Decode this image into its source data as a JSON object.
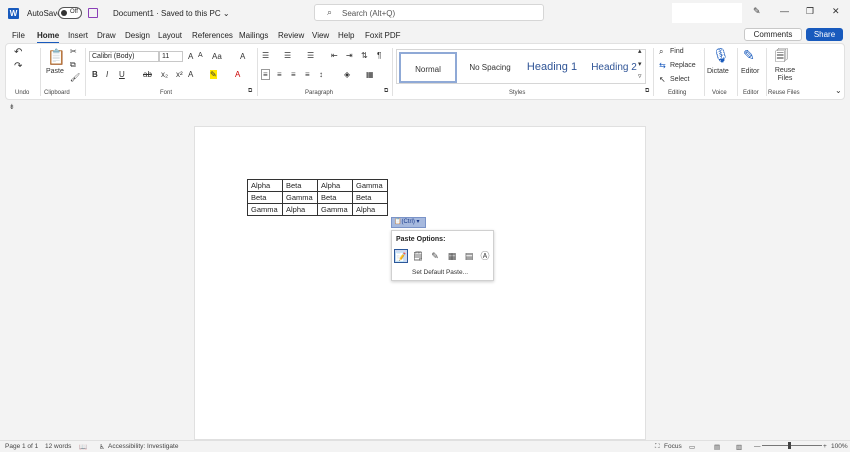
{
  "titlebar": {
    "app_icon": "W",
    "autosave_label": "AutoSave",
    "autosave_state": "Off",
    "doc_title": "Document1  ·  Saved to this PC  ⌄",
    "search_placeholder": "Search (Alt+Q)"
  },
  "menu": {
    "tabs": [
      "File",
      "Home",
      "Insert",
      "Draw",
      "Design",
      "Layout",
      "References",
      "Mailings",
      "Review",
      "View",
      "Help",
      "Foxit PDF"
    ],
    "active_tab": "Home",
    "comments": "Comments",
    "share": "Share"
  },
  "ribbon": {
    "clipboard": {
      "paste": "Paste",
      "label": "Clipboard"
    },
    "undo_label": "Undo",
    "font": {
      "name": "Calibri (Body)",
      "size": "11",
      "label": "Font"
    },
    "paragraph_label": "Paragraph",
    "styles": {
      "items": [
        "Normal",
        "No Spacing",
        "Heading 1",
        "Heading 2"
      ],
      "label": "Styles"
    },
    "editing": {
      "find": "Find",
      "replace": "Replace",
      "select": "Select",
      "label": "Editing"
    },
    "voice": {
      "dictate": "Dictate",
      "label": "Voice"
    },
    "editor": {
      "editor": "Editor",
      "label": "Editor"
    },
    "reuse": {
      "button": "Reuse Files",
      "label": "Reuse Files"
    }
  },
  "document": {
    "table": [
      [
        "Alpha",
        "Beta",
        "Alpha",
        "Gamma"
      ],
      [
        "Beta",
        "Gamma",
        "Beta",
        "Beta"
      ],
      [
        "Gamma",
        "Alpha",
        "Gamma",
        "Alpha"
      ]
    ]
  },
  "paste_popup": {
    "chip_label": "(Ctrl) ▾",
    "title": "Paste Options:",
    "set_default": "Set Default Paste..."
  },
  "statusbar": {
    "page": "Page 1 of 1",
    "words": "12 words",
    "accessibility": "Accessibility: Investigate",
    "focus": "Focus",
    "zoom": "100%"
  },
  "colors": {
    "accent": "#185abd",
    "paste_chip": "#a6b9de"
  }
}
